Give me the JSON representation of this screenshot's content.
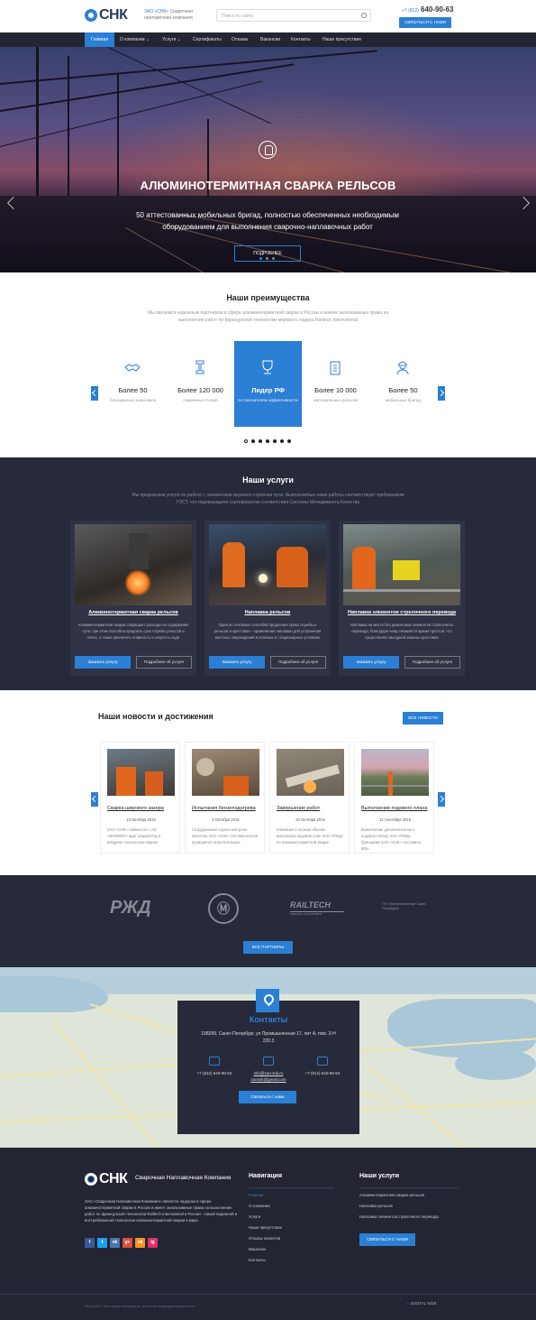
{
  "header": {
    "logo": "СНК",
    "tagline_brand": "ЗАО «СНК»",
    "tagline_rest": "Сварочная наплавочная компания",
    "search_placeholder": "Поиск по сайту",
    "phone_prefix": "+7 (812)",
    "phone": "640-90-63",
    "contact_button": "СВЯЗАТЬСЯ С НАМИ"
  },
  "nav": [
    "Главная",
    "О компании",
    "Услуги",
    "Сертификаты",
    "Отзывы",
    "Вакансии",
    "Контакты",
    "Наше присутствие"
  ],
  "hero": {
    "title": "АЛЮМИНОТЕРМИТНАЯ СВАРКА РЕЛЬСОВ",
    "subtitle": "50 аттестованных мобильных бригад, полностью обеспеченных необходимым оборудованием для выполнения сварочно-наплавочных работ",
    "button": "ПОДРОБНЕЕ",
    "slide_count": 3,
    "active_slide": 1
  },
  "advantages": {
    "title": "Наши преимущества",
    "description": "Мы являемся надежным партнером в сфере алюминотермитной сварки в России и имеем эксклюзивные права на выполнение работ по французской технологии мирового лидера Railtech International",
    "items": [
      {
        "value": "Более 50",
        "label": "благодарных заказчиков",
        "icon": "handshake-icon"
      },
      {
        "value": "Более 120 000",
        "label": "сваренных стыков",
        "icon": "rail-icon"
      },
      {
        "value": "Лидер РФ",
        "label": "по показателям эффективности",
        "icon": "trophy-icon"
      },
      {
        "value": "Более 10 000",
        "label": "наплавленных рельсов",
        "icon": "clipboard-icon"
      },
      {
        "value": "Более 50",
        "label": "мобильных бригад",
        "icon": "worker-icon"
      }
    ],
    "page_count": 7
  },
  "services": {
    "title": "Наши услуги",
    "description": "Мы предлагаем услуги по работе с элементами верхнего строения пути. Выполняемые нами работы соответствуют требованиям ГОСТ, что подтверждено сертификатом соответствия Системы Менеджмента Качества",
    "items": [
      {
        "name": "Алюминотермитная сварка рельсов",
        "text": "Алюминотермитная сварка сокращает расходы на содержание пути, при этом способна продлить срок службы рельсов и колес, а также увеличить плавность и скорость хода"
      },
      {
        "name": "Наплавка рельсов",
        "text": "Один из основных способов продления срока службы и рельсов и крестовин - применение наплавки для устранения местных повреждений в полевых и стационарных условиях"
      },
      {
        "name": "Наплавка элементов стрелочного перевода",
        "text": "Наплавка на месте без демонтажа элементов стрелочного перевода, благодаря чему снижается время простоя, что существенно выгодней замены крестовин"
      }
    ],
    "order_button": "Заказать услугу",
    "more_button": "Подробнее об услуге"
  },
  "news": {
    "title": "Наши новости и достижения",
    "all_button": "ВСЕ НОВОСТИ",
    "items": [
      {
        "title": "Сварка широкого зазора",
        "date": "13 Октября 2016",
        "text": "ЗАО «СНК» совместно с АО «ВНИИЖТ» идет разработку и внедряет технологию сварки"
      },
      {
        "title": "Испытания бензоподогрева",
        "date": "6 Октября 2016",
        "text": "Сотрудниками отдела контроля качества ЗАО «СНК» систематически проводятся испытательные"
      },
      {
        "title": "Завершение работ",
        "date": "20 Октября 2016",
        "text": "Компания в полном объеме выполнила подовой план ЗАО «РЖД» по алюминотермитной сварке"
      },
      {
        "title": "Выполнение подового плана",
        "date": "12 Сентября 2016",
        "text": "Выполнение дополнительного подового плану ЗАО «РЖД» бригадами ЗАО «СНК» составило 80%"
      }
    ]
  },
  "partners": {
    "logos": [
      "РЖД",
      "Метрополитен",
      "RAILTECH",
      "ГУП Электротранспорт Санкт-Петербурга"
    ],
    "railtech_tagline": "WELDING & EQUIPMENT",
    "button": "ВСЕ ПАРТНЕРЫ"
  },
  "contacts": {
    "title": "Контакты",
    "address": "198299, Санкт-Петербург, ул Промышленная 17, лит А, пом. 2-Н 220.3",
    "phone1": "+7 (812) 640-90-63",
    "email1": "info@zao-snk.ru",
    "email2": "zaosnk@gmail.com",
    "phone2": "+7 (812) 640-90-63",
    "button": "Связаться с нами"
  },
  "footer": {
    "logo": "СНК",
    "company": "Сварочная Наплавочная Компания",
    "about": "ЗАО «Сварочная Наплавочная Компания» является лидером в сфере алюминотермитной сварки в России и имеет эксклюзивные права на выполнение работ по французской технологии Railtech International в России - самой надежной и востребованной технологии алюминотермитной сварки в мире.",
    "social": [
      "f",
      "t",
      "vk",
      "g+",
      "ok",
      "ig"
    ],
    "social_colors": [
      "#3b5998",
      "#1da1f2",
      "#4a76a8",
      "#dc4e41",
      "#f7931e",
      "#e1306c"
    ],
    "nav_title": "Навигация",
    "nav_links": [
      "Главная",
      "О компании",
      "Услуги",
      "Наше присутствие",
      "Отзывы клиентов",
      "Вакансии",
      "Контакты"
    ],
    "services_title": "Наши услуги",
    "service_links": [
      "Алюминотермитная сварка рельсов",
      "Наплавка рельсов",
      "Наплавка элементов стрелочного перевода"
    ],
    "contact_button": "СВЯЗАТЬСЯ С НАМИ",
    "copyright": "2016-2017. Все права защищены, политика конфиденциальности",
    "developer": "DIGITAL WEB"
  },
  "colors": {
    "accent": "#2b7fd4",
    "dark": "#272a3a",
    "nav": "#232533"
  }
}
